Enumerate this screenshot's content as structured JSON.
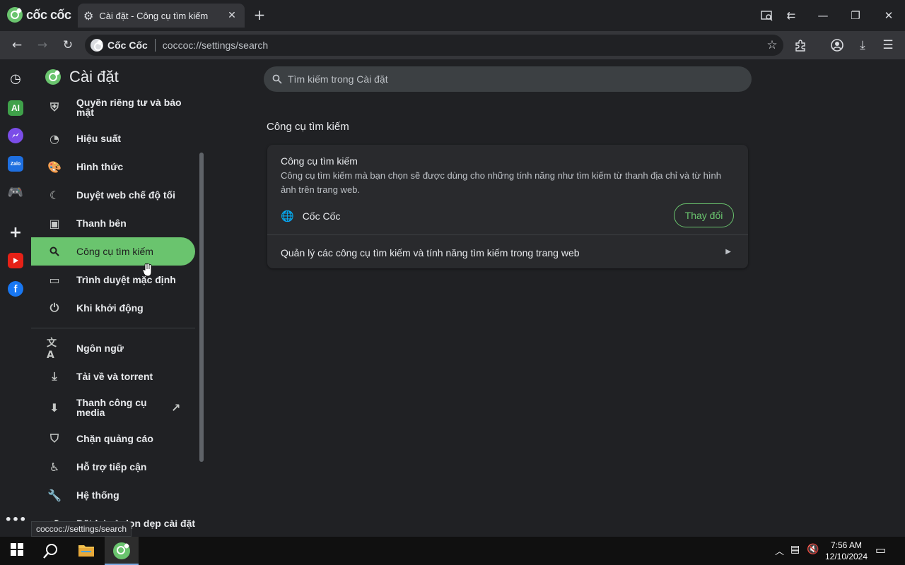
{
  "browser": {
    "brand": "cốc cốc",
    "tab_title": "Cài đặt - Công cụ tìm kiếm",
    "site_label": "Cốc Cốc",
    "url": "coccoc://settings/search"
  },
  "settings": {
    "title": "Cài đặt",
    "search_placeholder": "Tìm kiếm trong Cài đặt",
    "nav": [
      {
        "label": "Quyền riêng tư và bảo mật",
        "icon": "shield-icon"
      },
      {
        "label": "Hiệu suất",
        "icon": "speedometer-icon"
      },
      {
        "label": "Hình thức",
        "icon": "palette-icon"
      },
      {
        "label": "Duyệt web chế độ tối",
        "icon": "moon-icon"
      },
      {
        "label": "Thanh bên",
        "icon": "sidebar-icon"
      },
      {
        "label": "Công cụ tìm kiếm",
        "icon": "search-icon",
        "active": true
      },
      {
        "label": "Trình duyệt mặc định",
        "icon": "browser-window-icon"
      },
      {
        "label": "Khi khởi động",
        "icon": "power-icon"
      },
      {
        "label": "Ngôn ngữ",
        "icon": "translate-icon"
      },
      {
        "label": "Tải về và torrent",
        "icon": "download-icon"
      },
      {
        "label": "Thanh công cụ media",
        "icon": "media-icon"
      },
      {
        "label": "Chặn quảng cáo",
        "icon": "ad-block-shield-icon"
      },
      {
        "label": "Hỗ trợ tiếp cận",
        "icon": "accessibility-icon"
      },
      {
        "label": "Hệ thống",
        "icon": "wrench-icon"
      },
      {
        "label": "Đặt lại và dọn dẹp cài đặt",
        "icon": "reset-icon"
      }
    ],
    "status_url": "coccoc://settings/search"
  },
  "main": {
    "section_title": "Công cụ tìm kiếm",
    "card": {
      "heading": "Công cụ tìm kiếm",
      "description": "Công cụ tìm kiếm mà bạn chọn sẽ được dùng cho những tính năng như tìm kiếm từ thanh địa chỉ và từ hình ảnh trên trang web.",
      "engine": "Cốc Cốc",
      "change_label": "Thay đổi",
      "manage_label": "Quản lý các công cụ tìm kiếm và tính năng tìm kiếm trong trang web"
    }
  },
  "taskbar": {
    "time": "7:56 AM",
    "date": "12/10/2024"
  },
  "colors": {
    "accent": "#6ac46e",
    "background": "#202124",
    "card": "#292a2d"
  }
}
